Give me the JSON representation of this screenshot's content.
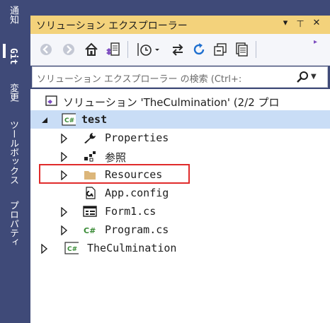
{
  "left_strip": {
    "tabs": [
      "通知",
      "Git",
      "変更",
      "ツールボックス",
      "プロパティ"
    ]
  },
  "panel": {
    "title": "ソリューション エクスプローラー",
    "buttons": [
      {
        "name": "dropdown",
        "glyph": "▾"
      },
      {
        "name": "pin",
        "glyph": "⊥"
      },
      {
        "name": "close",
        "glyph": "✕"
      }
    ]
  },
  "toolbar": {
    "overflow_glyph": "▸",
    "items": [
      "back-icon",
      "forward-icon",
      "home-icon",
      "switch-views-icon",
      "pending-changes-filter-icon",
      "sync-active-document-icon",
      "refresh-icon",
      "collapse-all-icon",
      "show-all-files-icon"
    ]
  },
  "search": {
    "placeholder": "ソリューション エクスプローラー の検索 (Ctrl+:"
  },
  "tree": {
    "solution_label": "ソリューション 'TheCulmination' (2/2 プロ",
    "project_label": "test",
    "children": [
      {
        "label": "Properties",
        "icon": "wrench-icon"
      },
      {
        "label": "参照",
        "icon": "references-icon"
      },
      {
        "label": "Resources",
        "icon": "folder-icon",
        "highlighted": true
      },
      {
        "label": "App.config",
        "icon": "config-file-icon"
      },
      {
        "label": "Form1.cs",
        "icon": "form-icon"
      },
      {
        "label": "Program.cs",
        "icon": "csharp-file-icon"
      }
    ],
    "second_project_label": "TheCulmination"
  },
  "colors": {
    "frame": "#3f4a78",
    "title_bar": "#f3d27b",
    "selection": "#c9ddf6",
    "highlight_border": "#e02b2b",
    "csharp_green": "#388a34"
  }
}
